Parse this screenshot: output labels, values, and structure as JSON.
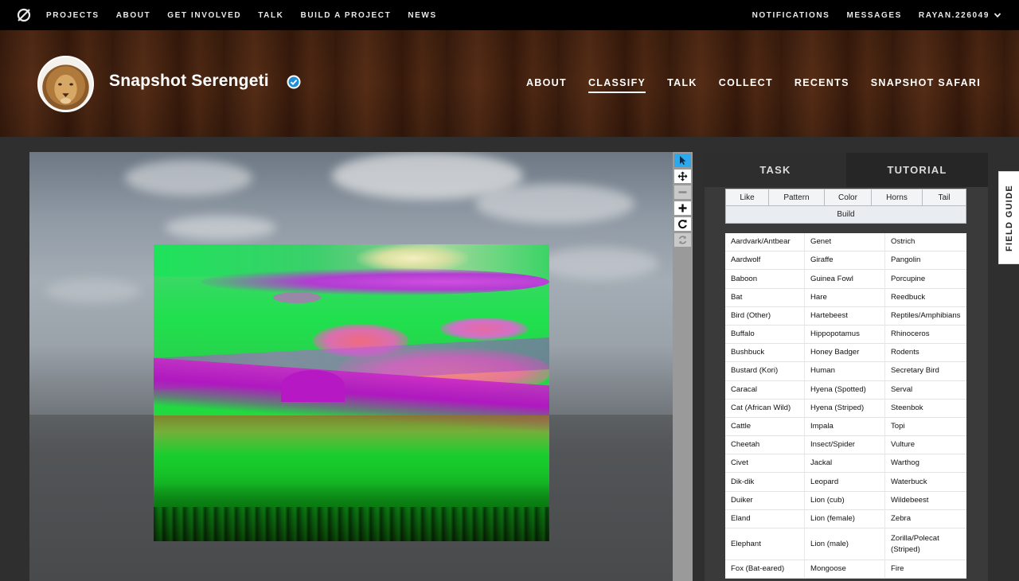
{
  "topnav": {
    "left": [
      "PROJECTS",
      "ABOUT",
      "GET INVOLVED",
      "TALK",
      "BUILD A PROJECT",
      "NEWS"
    ],
    "right": [
      "NOTIFICATIONS",
      "MESSAGES"
    ],
    "user": "RAYAN.226049"
  },
  "project": {
    "title": "Snapshot Serengeti",
    "nav": [
      "ABOUT",
      "CLASSIFY",
      "TALK",
      "COLLECT",
      "RECENTS",
      "SNAPSHOT SAFARI"
    ],
    "active_nav": "CLASSIFY"
  },
  "classifier": {
    "tabs": {
      "task": "TASK",
      "tutorial": "TUTORIAL"
    },
    "filters": [
      "Like",
      "Pattern",
      "Color",
      "Horns",
      "Tail"
    ],
    "build": "Build",
    "species": [
      [
        "Aardvark/Antbear",
        "Genet",
        "Ostrich"
      ],
      [
        "Aardwolf",
        "Giraffe",
        "Pangolin"
      ],
      [
        "Baboon",
        "Guinea Fowl",
        "Porcupine"
      ],
      [
        "Bat",
        "Hare",
        "Reedbuck"
      ],
      [
        "Bird (Other)",
        "Hartebeest",
        "Reptiles/Amphibians"
      ],
      [
        "Buffalo",
        "Hippopotamus",
        "Rhinoceros"
      ],
      [
        "Bushbuck",
        "Honey Badger",
        "Rodents"
      ],
      [
        "Bustard (Kori)",
        "Human",
        "Secretary Bird"
      ],
      [
        "Caracal",
        "Hyena (Spotted)",
        "Serval"
      ],
      [
        "Cat (African Wild)",
        "Hyena (Striped)",
        "Steenbok"
      ],
      [
        "Cattle",
        "Impala",
        "Topi"
      ],
      [
        "Cheetah",
        "Insect/Spider",
        "Vulture"
      ],
      [
        "Civet",
        "Jackal",
        "Warthog"
      ],
      [
        "Dik-dik",
        "Leopard",
        "Waterbuck"
      ],
      [
        "Duiker",
        "Lion (cub)",
        "Wildebeest"
      ],
      [
        "Eland",
        "Lion (female)",
        "Zebra"
      ],
      [
        "Elephant",
        "Lion (male)",
        "Zorilla/Polecat (Striped)"
      ],
      [
        "Fox (Bat-eared)",
        "Mongoose",
        "Fire"
      ]
    ]
  },
  "field_guide": "FIELD GUIDE",
  "icons": {
    "logo": "zooniverse-logo-icon",
    "verified": "verified-check-icon",
    "toolbar": [
      "pointer-icon",
      "move-icon",
      "zoom-out-icon",
      "zoom-in-icon",
      "rotate-icon",
      "reset-icon"
    ]
  }
}
